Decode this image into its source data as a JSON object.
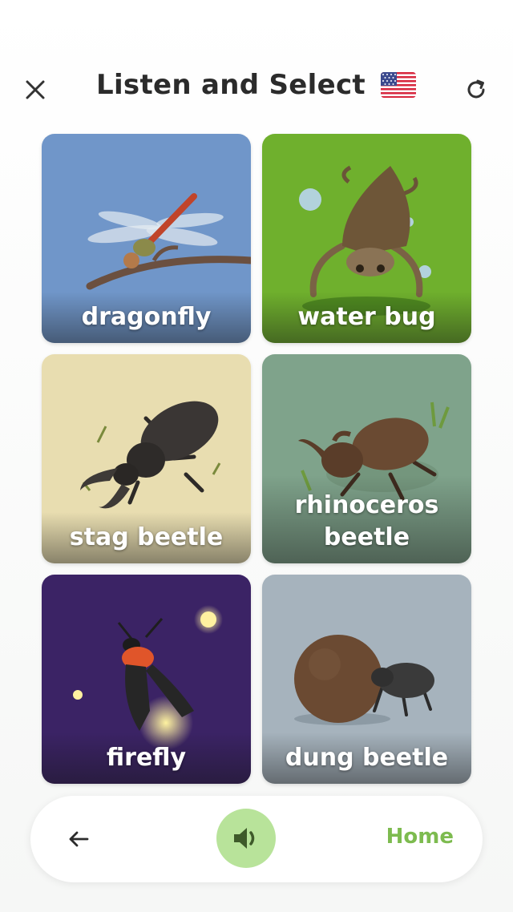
{
  "header": {
    "title": "Listen and Select",
    "close_icon": "close-icon",
    "flag_icon": "us-flag-icon",
    "refresh_icon": "refresh-icon"
  },
  "cards": [
    {
      "label": "dragonfly",
      "bg": "#7096c9"
    },
    {
      "label": "water bug",
      "bg": "#6fb02d"
    },
    {
      "label": "stag beetle",
      "bg": "#e8ddb0"
    },
    {
      "label": "rhinoceros beetle",
      "bg": "#7fa38b"
    },
    {
      "label": "firefly",
      "bg": "#3b2365"
    },
    {
      "label": "dung beetle",
      "bg": "#a6b3bd"
    }
  ],
  "bottom_bar": {
    "back_icon": "arrow-left-icon",
    "sound_icon": "speaker-icon",
    "home_label": "Home"
  },
  "colors": {
    "accent": "#7dbb4f",
    "sound_button": "#b8e39a",
    "title": "#2b2b2b"
  }
}
